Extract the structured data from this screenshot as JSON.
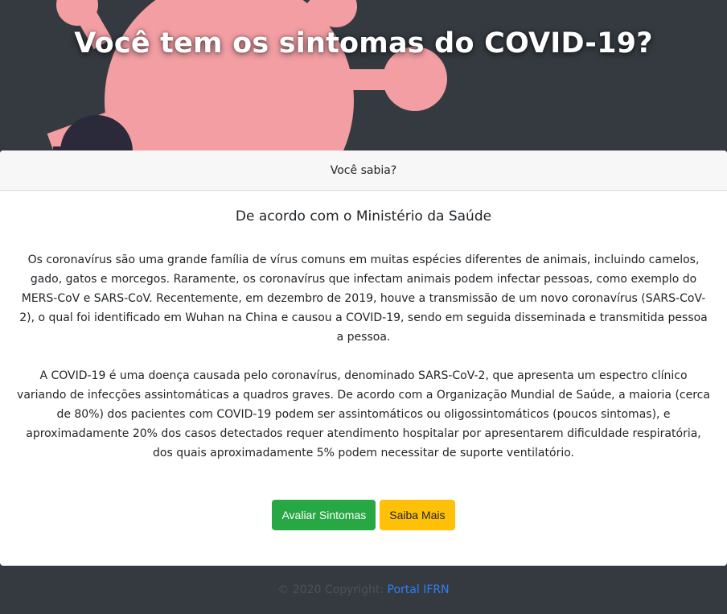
{
  "hero": {
    "title": "Você tem os sintomas do COVID-19?"
  },
  "card": {
    "header": "Você sabia?",
    "title": "De acordo com o Ministério da Saúde",
    "paragraphs": [
      "Os coronavírus são uma grande família de vírus comuns em muitas espécies diferentes de animais, incluindo camelos, gado, gatos e morcegos. Raramente, os coronavírus que infectam animais podem infectar pessoas, como exemplo do MERS-CoV e SARS-CoV. Recentemente, em dezembro de 2019, houve a transmissão de um novo coronavírus (SARS-CoV-2), o qual foi identificado em Wuhan na China e causou a COVID-19, sendo em seguida disseminada e transmitida pessoa a pessoa.",
      "A COVID-19 é uma doença causada pelo coronavírus, denominado SARS-CoV-2, que apresenta um espectro clínico variando de infecções assintomáticas a quadros graves. De acordo com a Organização Mundial de Saúde, a maioria (cerca de 80%) dos pacientes com COVID-19 podem ser assintomáticos ou oligossintomáticos (poucos sintomas), e aproximadamente 20% dos casos detectados requer atendimento hospitalar por apresentarem dificuldade respiratória, dos quais aproximadamente 5% podem necessitar de suporte ventilatório."
    ],
    "buttons": {
      "evaluate": "Avaliar Sintomas",
      "learn_more": "Saiba Mais"
    }
  },
  "footer": {
    "copyright": "© 2020 Copyright: ",
    "link": "Portal IFRN"
  },
  "colors": {
    "background": "#343a40",
    "virus": "#f29ea3",
    "evaluate_button": "#28a745",
    "learn_more_button": "#ffc107",
    "link": "#007bff"
  }
}
